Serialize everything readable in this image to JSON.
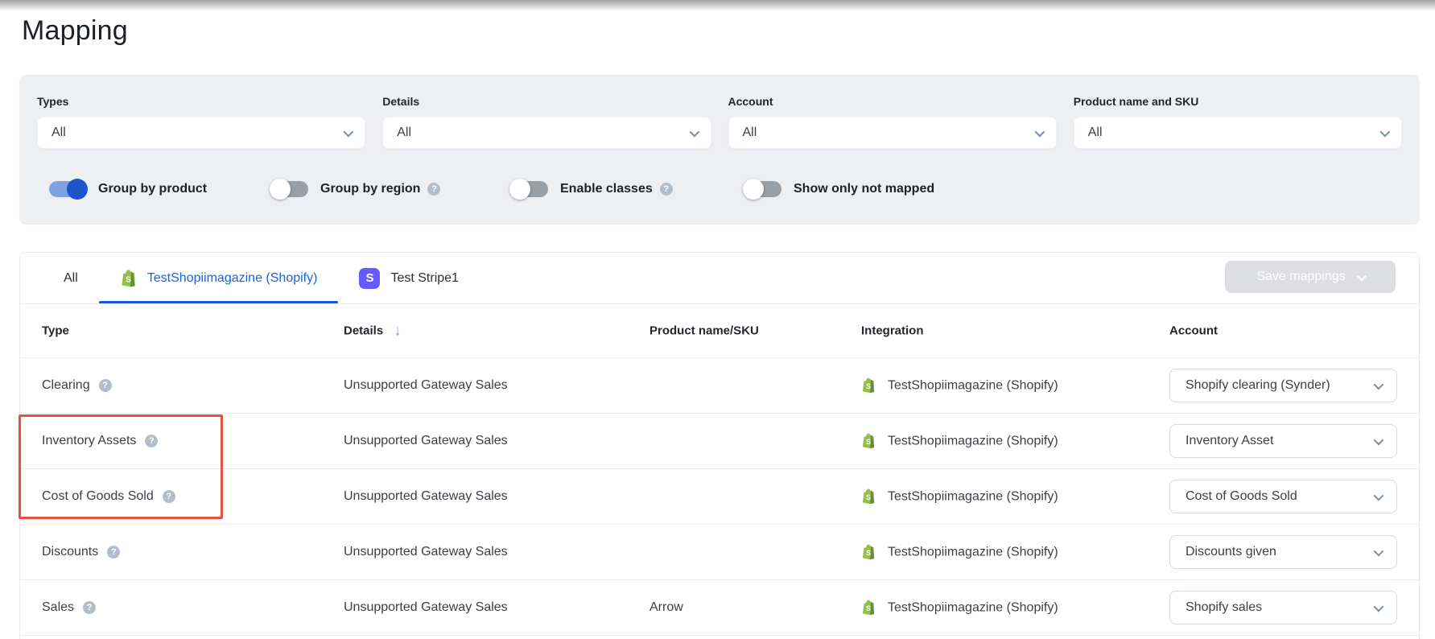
{
  "page": {
    "title": "Mapping"
  },
  "colors": {
    "accent_blue": "#1b63d6",
    "toggle_on": "#1d54c9",
    "shopify_green": "#95BF47",
    "stripe_purple": "#635bff",
    "annotation_red": "#e8513f",
    "panel_bg": "#edeff3"
  },
  "filters": {
    "fields": [
      {
        "label": "Types",
        "value": "All"
      },
      {
        "label": "Details",
        "value": "All"
      },
      {
        "label": "Account",
        "value": "All"
      },
      {
        "label": "Product name and SKU",
        "value": "All"
      }
    ],
    "toggles": [
      {
        "label": "Group by product",
        "on": true,
        "help": false
      },
      {
        "label": "Group by region",
        "on": false,
        "help": true
      },
      {
        "label": "Enable classes",
        "on": false,
        "help": true
      },
      {
        "label": "Show only not mapped",
        "on": false,
        "help": false
      }
    ]
  },
  "tabs": [
    {
      "label": "All",
      "icon": "",
      "active": false
    },
    {
      "label": "TestShopiimagazine (Shopify)",
      "icon": "shopify-icon",
      "active": true
    },
    {
      "label": "Test Stripe1",
      "icon": "stripe-icon",
      "active": false
    }
  ],
  "stripe_badge_letter": "S",
  "toolbar": {
    "save_label": "Save mappings",
    "disabled": true
  },
  "table": {
    "columns": [
      "Type",
      "Details",
      "Product name/SKU",
      "Integration",
      "Account"
    ],
    "sorted_column": {
      "label": "Details",
      "direction": "desc"
    },
    "rows": [
      {
        "type": "Clearing",
        "details": "Unsupported Gateway Sales",
        "product": "",
        "integration": "TestShopiimagazine (Shopify)",
        "account": "Shopify clearing (Synder)",
        "highlighted": false
      },
      {
        "type": "Inventory Assets",
        "details": "Unsupported Gateway Sales",
        "product": "",
        "integration": "TestShopiimagazine (Shopify)",
        "account": "Inventory Asset",
        "highlighted": true
      },
      {
        "type": "Cost of Goods Sold",
        "details": "Unsupported Gateway Sales",
        "product": "",
        "integration": "TestShopiimagazine (Shopify)",
        "account": "Cost of Goods Sold",
        "highlighted": true
      },
      {
        "type": "Discounts",
        "details": "Unsupported Gateway Sales",
        "product": "",
        "integration": "TestShopiimagazine (Shopify)",
        "account": "Discounts given",
        "highlighted": false
      },
      {
        "type": "Sales",
        "details": "Unsupported Gateway Sales",
        "product": "Arrow",
        "integration": "TestShopiimagazine (Shopify)",
        "account": "Shopify sales",
        "highlighted": false
      }
    ]
  },
  "annotation": {
    "shape": "red-rectangle",
    "covers": [
      "Inventory Assets",
      "Cost of Goods Sold"
    ]
  }
}
